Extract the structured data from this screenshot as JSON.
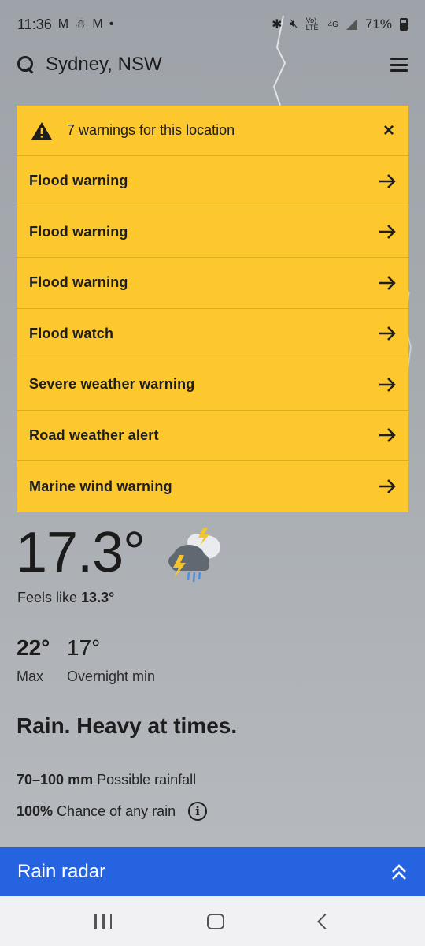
{
  "status_bar": {
    "time": "11:36",
    "battery": "71%",
    "notification_icons": [
      "gmail-icon",
      "app-icon",
      "gmail-icon",
      "dot-icon"
    ],
    "system_icons": [
      "bluetooth-icon",
      "mute-icon",
      "volte-icon",
      "4g-icon",
      "signal-icon",
      "battery-icon"
    ],
    "volte_text": "Vo) LTE",
    "network_text": "4G"
  },
  "header": {
    "location": "Sydney, NSW"
  },
  "warnings": {
    "title": "7 warnings for this location",
    "close_symbol": "×",
    "items": [
      {
        "label": "Flood warning"
      },
      {
        "label": "Flood warning"
      },
      {
        "label": "Flood warning"
      },
      {
        "label": "Flood watch"
      },
      {
        "label": "Severe weather warning"
      },
      {
        "label": "Road weather alert"
      },
      {
        "label": "Marine wind warning"
      }
    ],
    "color": "#fdc72e"
  },
  "current": {
    "temperature": "17.3°",
    "feels_like_label": "Feels like",
    "feels_like_value": "13.3°",
    "icon": "thunderstorm-rain-icon"
  },
  "today": {
    "max": "22°",
    "max_label": "Max",
    "min": "17°",
    "min_label": "Overnight min",
    "forecast": "Rain. Heavy at times.",
    "rainfall_value": "70–100 mm",
    "rainfall_label": "Possible rainfall",
    "chance_value": "100%",
    "chance_label": "Chance of any rain",
    "info_symbol": "i"
  },
  "radar": {
    "label": "Rain radar",
    "color": "#2563e0"
  },
  "nav": {
    "items": [
      "recent-apps",
      "home",
      "back"
    ]
  }
}
